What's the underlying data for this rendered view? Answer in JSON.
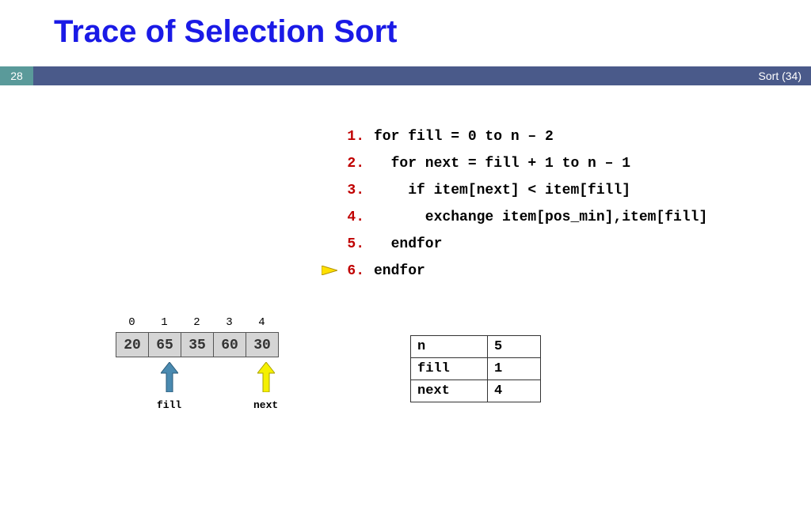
{
  "title": "Trace of Selection Sort",
  "slide_number": "28",
  "footer": "Sort (34)",
  "code": {
    "current_line_index": 5,
    "lines": [
      {
        "num": "1.",
        "text": "for fill = 0 to n – 2"
      },
      {
        "num": "2.",
        "text": "  for next = fill + 1 to n – 1"
      },
      {
        "num": "3.",
        "text": "    if item[next] < item[fill]"
      },
      {
        "num": "4.",
        "text": "      exchange item[pos_min],item[fill]"
      },
      {
        "num": "5.",
        "text": "  endfor"
      },
      {
        "num": "6.",
        "text": "endfor"
      }
    ]
  },
  "array": {
    "indices": [
      "0",
      "1",
      "2",
      "3",
      "4"
    ],
    "values": [
      "20",
      "65",
      "35",
      "60",
      "30"
    ]
  },
  "pointers": {
    "fill_label": "fill",
    "next_label": "next"
  },
  "vars": [
    {
      "name": "n",
      "value": "5"
    },
    {
      "name": "fill",
      "value": "1"
    },
    {
      "name": "next",
      "value": "4"
    }
  ]
}
